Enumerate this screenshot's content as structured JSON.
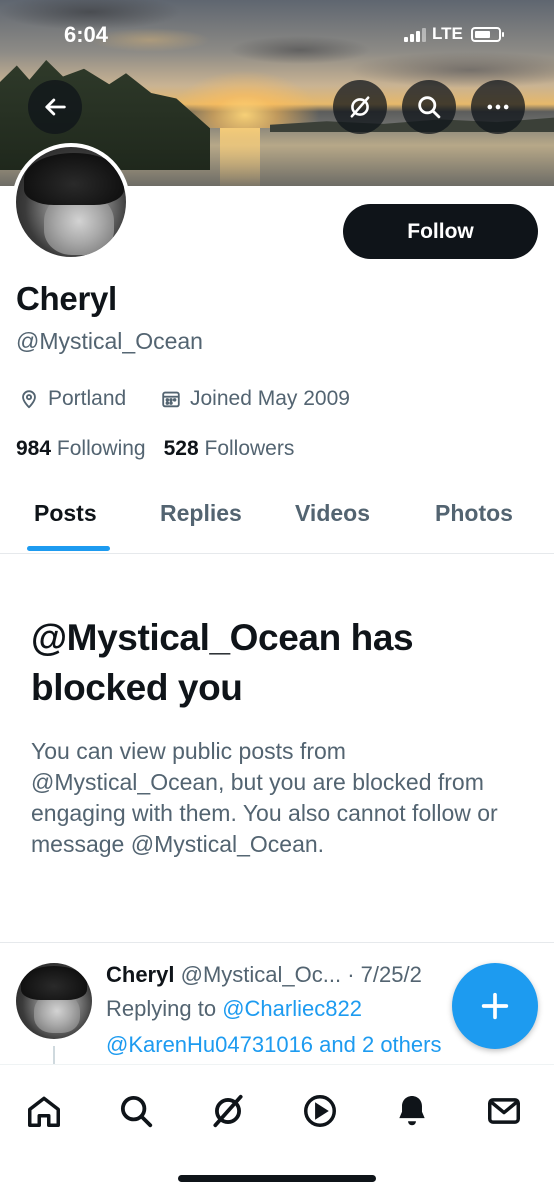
{
  "status_bar": {
    "time": "6:04",
    "network": "LTE"
  },
  "header_actions": {
    "back_icon": "arrow-left-icon",
    "grok_icon": "slashed-circle-icon",
    "search_icon": "search-icon",
    "more_icon": "more-dots-icon"
  },
  "profile": {
    "name": "Cheryl",
    "handle": "@Mystical_Ocean",
    "follow_label": "Follow",
    "location": "Portland",
    "joined": "Joined May 2009",
    "following_count": "984",
    "following_label": "Following",
    "followers_count": "528",
    "followers_label": "Followers"
  },
  "tabs": [
    {
      "label": "Posts",
      "active": true
    },
    {
      "label": "Replies",
      "active": false
    },
    {
      "label": "Videos",
      "active": false
    },
    {
      "label": "Photos",
      "active": false
    }
  ],
  "blocked": {
    "title": "@Mystical_Ocean has blocked you",
    "body": "You can view public posts from @Mystical_Ocean, but you are blocked from engaging with them. You also cannot follow or message @Mystical_Ocean."
  },
  "post": {
    "name": "Cheryl",
    "handle": "@Mystical_Oc...",
    "date": "· 7/25/2",
    "replying_prefix": "Replying to",
    "reply_target": "@Charliec822",
    "reply_line2": "@KarenHu04731016 and 2 others"
  },
  "bottom_nav": [
    "home-icon",
    "search-icon",
    "grok-icon",
    "play-icon",
    "bell-icon",
    "mail-icon"
  ],
  "colors": {
    "accent": "#1d9bf0",
    "text": "#0f1419",
    "muted": "#536471"
  }
}
